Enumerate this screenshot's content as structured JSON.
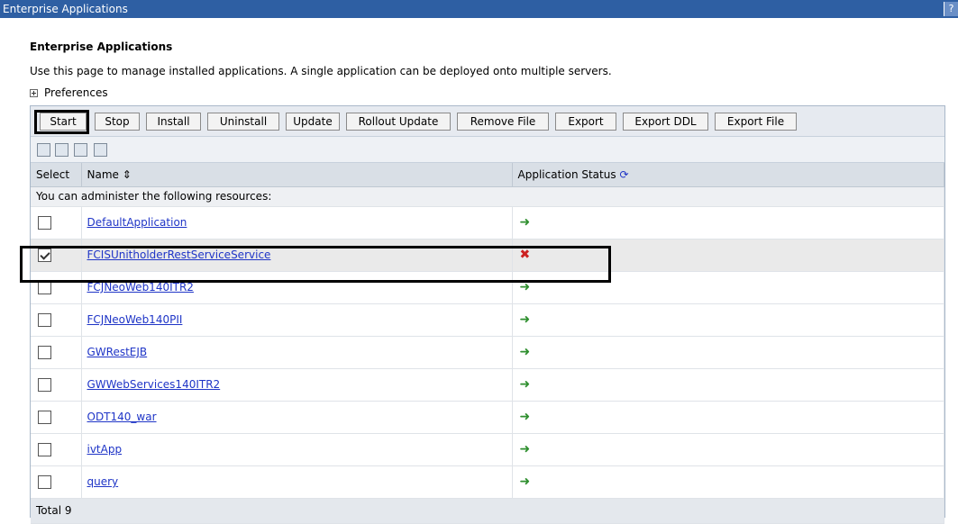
{
  "window": {
    "title": "Enterprise Applications",
    "help_icon": "?"
  },
  "page": {
    "heading": "Enterprise Applications",
    "description": "Use this page to manage installed applications. A single application can be deployed onto multiple servers.",
    "preferences_label": "Preferences"
  },
  "toolbar": {
    "buttons": [
      "Start",
      "Stop",
      "Install",
      "Uninstall",
      "Update",
      "Rollout Update",
      "Remove File",
      "Export",
      "Export DDL",
      "Export File"
    ],
    "icons": [
      "select-all-icon",
      "deselect-all-icon",
      "expand-filter-icon",
      "show-filter-icon"
    ]
  },
  "table": {
    "columns": {
      "select": "Select",
      "name": "Name",
      "status": "Application Status"
    },
    "info_row": "You can administer the following resources:",
    "rows": [
      {
        "name": "DefaultApplication",
        "status": "started",
        "checked": false
      },
      {
        "name": "FCISUnitholderRestServiceService",
        "status": "stopped",
        "checked": true
      },
      {
        "name": "FCJNeoWeb140ITR2",
        "status": "started",
        "checked": false
      },
      {
        "name": "FCJNeoWeb140PII",
        "status": "started",
        "checked": false
      },
      {
        "name": "GWRestEJB",
        "status": "started",
        "checked": false
      },
      {
        "name": "GWWebServices140ITR2",
        "status": "started",
        "checked": false
      },
      {
        "name": "ODT140_war",
        "status": "started",
        "checked": false
      },
      {
        "name": "ivtApp",
        "status": "started",
        "checked": false
      },
      {
        "name": "query",
        "status": "started",
        "checked": false
      }
    ],
    "total": "Total 9"
  },
  "colors": {
    "titlebar": "#2e5fa3",
    "link": "#1f35c7",
    "started": "#2f8f2f",
    "stopped": "#cc2222"
  }
}
